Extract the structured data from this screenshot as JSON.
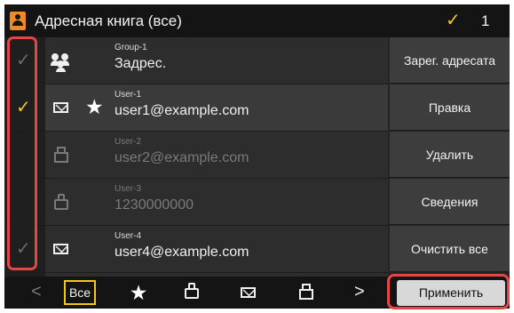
{
  "header": {
    "title": "Адресная книга (все)",
    "selected_count": "1"
  },
  "rows": [
    {
      "type": "group",
      "label": "Group-1",
      "value": "Задрес.",
      "checked": false,
      "favorite": false,
      "enabled": true
    },
    {
      "type": "email",
      "label": "User-1",
      "value": "user1@example.com",
      "checked": true,
      "favorite": true,
      "enabled": true
    },
    {
      "type": "fax",
      "label": "User-2",
      "value": "user2@example.com",
      "checked": false,
      "favorite": false,
      "enabled": false
    },
    {
      "type": "server",
      "label": "User-3",
      "value": "1230000000",
      "checked": false,
      "favorite": false,
      "enabled": false
    },
    {
      "type": "email",
      "label": "User-4",
      "value": "user4@example.com",
      "checked": false,
      "favorite": false,
      "enabled": true
    }
  ],
  "actions": {
    "register": "Зарег. адресата",
    "edit": "Правка",
    "delete": "Удалить",
    "details": "Сведения",
    "clear_all": "Очистить все"
  },
  "bottombar": {
    "prev": "<",
    "filter_all": "Все",
    "next": ">",
    "apply": "Применить"
  },
  "colors": {
    "accent_check": "#f5c518",
    "highlight": "#e84545",
    "book_icon": "#f08a24"
  },
  "icons": {
    "header": "address-book-icon",
    "checkmark": "checkmark-icon",
    "group": "group-icon",
    "email": "envelope-icon",
    "fax": "fax-icon",
    "server": "file-server-icon",
    "favorite": "star-icon"
  }
}
